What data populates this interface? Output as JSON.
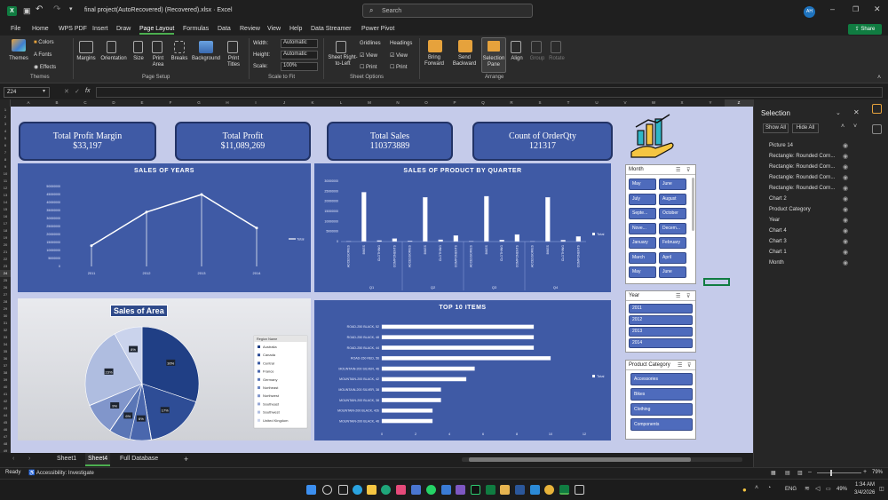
{
  "window": {
    "title": "final project(AutoRecovered) (Recovered).xlsx · Excel",
    "search": "Search",
    "user": "AH"
  },
  "menu": [
    "File",
    "Home",
    "WPS PDF",
    "Insert",
    "Draw",
    "Page Layout",
    "Formulas",
    "Data",
    "Review",
    "View",
    "Help",
    "Data Streamer",
    "Power Pivot"
  ],
  "share": "Share",
  "ribbon": {
    "themes": "Themes",
    "colors": "Colors",
    "fonts": "Fonts",
    "effects": "Effects",
    "themes_group": "Themes",
    "margins": "Margins",
    "orientation": "Orientation",
    "size": "Size",
    "print_area": "Print Area",
    "breaks": "Breaks",
    "background": "Background",
    "print_titles": "Print Titles",
    "page_setup_group": "Page Setup",
    "width": "Width:",
    "height": "Height:",
    "scale": "Scale:",
    "width_val": "Automatic",
    "height_val": "Automatic",
    "scale_val": "100%",
    "scale_group": "Scale to Fit",
    "sheet_rtl": "Sheet Right-to-Left",
    "gridlines": "Gridlines",
    "headings": "Headings",
    "view": "View",
    "print": "Print",
    "sheet_options_group": "Sheet Options",
    "bring_forward": "Bring Forward",
    "send_backward": "Send Backward",
    "selection_pane": "Selection Pane",
    "align": "Align",
    "group": "Group",
    "rotate": "Rotate",
    "arrange_group": "Arrange"
  },
  "formula": {
    "namebox": "Z24",
    "fx": "fx",
    "value": ""
  },
  "columns": [
    "A",
    "B",
    "C",
    "D",
    "E",
    "F",
    "G",
    "H",
    "I",
    "J",
    "K",
    "L",
    "M",
    "N",
    "O",
    "P",
    "Q",
    "R",
    "S",
    "T",
    "U",
    "V",
    "W",
    "X",
    "Y",
    "Z"
  ],
  "rows": [
    "1",
    "2",
    "3",
    "4",
    "5",
    "6",
    "7",
    "8",
    "9",
    "10",
    "11",
    "12",
    "13",
    "14",
    "15",
    "16",
    "17",
    "18",
    "19",
    "20",
    "21",
    "22",
    "23",
    "24",
    "25",
    "26",
    "27",
    "28",
    "29",
    "30",
    "31",
    "32",
    "33",
    "34",
    "35",
    "36",
    "37",
    "38",
    "39",
    "40",
    "41",
    "42",
    "43",
    "44",
    "45",
    "46",
    "47",
    "48",
    "49"
  ],
  "kpis": [
    {
      "title": "Total Profit Margin",
      "value": "$33,197"
    },
    {
      "title": "Total Profit",
      "value": "$11,089,269"
    },
    {
      "title": "Total Sales",
      "value": "110373889"
    },
    {
      "title": "Count of OrderQty",
      "value": "121317"
    }
  ],
  "chart_data": [
    {
      "type": "line",
      "title": "SALES OF YEARS",
      "categories": [
        "2011",
        "2012",
        "2013",
        "2014"
      ],
      "series": [
        {
          "name": "Total",
          "values": [
            13000000,
            34000000,
            45000000,
            24000000
          ]
        }
      ],
      "ylim": [
        0,
        50000000
      ],
      "yticks": [
        "0",
        "5000000",
        "10000000",
        "15000000",
        "20000000",
        "25000000",
        "30000000",
        "35000000",
        "40000000",
        "45000000",
        "50000000"
      ],
      "legend": "right"
    },
    {
      "type": "bar",
      "title": "SALES OF PRODUCT BY QUARTER",
      "quarters": [
        "Q1",
        "Q2",
        "Q3",
        "Q4"
      ],
      "categories": [
        "ACCESSORIES",
        "BIKES",
        "CLOTHING",
        "COMPONENTS",
        "ACCESSORIES",
        "BIKES",
        "CLOTHING",
        "COMPONENTS",
        "ACCESSORIES",
        "BIKES",
        "CLOTHING",
        "COMPONENTS",
        "ACCESSORIES",
        "BIKES",
        "CLOTHING",
        "COMPONENTS"
      ],
      "series": [
        {
          "name": "Total",
          "values": [
            100000,
            24500000,
            500000,
            1500000,
            300000,
            22000000,
            900000,
            3000000,
            200000,
            22500000,
            800000,
            3500000,
            150000,
            22000000,
            700000,
            2500000
          ]
        }
      ],
      "ylim": [
        0,
        30000000
      ],
      "yticks": [
        "0",
        "5000000",
        "10000000",
        "15000000",
        "20000000",
        "25000000",
        "30000000"
      ],
      "legend": "right"
    },
    {
      "type": "pie",
      "title": "Sales of Area",
      "legend_title": "Region Name",
      "labels": [
        "Australia",
        "Canada",
        "Central",
        "France",
        "Germany",
        "Northeast",
        "Northwest",
        "Southeast",
        "Southwest",
        "United Kingdom"
      ],
      "values": [
        30,
        17,
        0.1,
        6,
        6,
        0.1,
        9,
        0.1,
        23,
        8
      ],
      "data_labels": [
        "30%",
        "17%",
        "0%",
        "6%",
        "6%",
        "0%",
        "9%",
        "0%",
        "23%",
        "8%"
      ],
      "legend": "right"
    },
    {
      "type": "bar",
      "orientation": "horizontal",
      "title": "TOP 10 ITEMS",
      "categories": [
        "ROAD-250 BLACK, 52",
        "ROAD-250 BLACK, 48",
        "ROAD-250 BLACK, 44",
        "ROAD-150 RED, 56",
        "MOUNTAIN-200 SILVER, 46",
        "MOUNTAIN-200 BLACK, 42",
        "MOUNTAIN-200 SILVER, 38",
        "MOUNTAIN-200 BLACK, 38",
        "MOUNTAIN-200 BLACK, 42b",
        "MOUNTAIN-200 BLACK, 46"
      ],
      "series": [
        {
          "name": "Total",
          "values": [
            9,
            9,
            9,
            10,
            5.5,
            5,
            3.5,
            3.5,
            3,
            3
          ]
        }
      ],
      "xlim": [
        0,
        12
      ],
      "xticks": [
        "0",
        "2",
        "4",
        "6",
        "8",
        "10",
        "12"
      ],
      "legend": "right"
    }
  ],
  "slicers": {
    "month": {
      "title": "Month",
      "items": [
        "May",
        "June",
        "July",
        "August",
        "Septe...",
        "October",
        "Nove...",
        "Decem...",
        "January",
        "February",
        "March",
        "April",
        "May",
        "June"
      ]
    },
    "year": {
      "title": "Year",
      "items": [
        "2011",
        "2012",
        "2013",
        "2014"
      ]
    },
    "category": {
      "title": "Product Category",
      "items": [
        "Accessories",
        "Bikes",
        "Clothing",
        "Components"
      ]
    }
  },
  "selection_pane": {
    "title": "Selection",
    "show_all": "Show All",
    "hide_all": "Hide All",
    "items": [
      "Picture 14",
      "Rectangle: Rounded Corn...",
      "Rectangle: Rounded Corn...",
      "Rectangle: Rounded Corn...",
      "Rectangle: Rounded Corn...",
      "Chart 2",
      "Product Category",
      "Year",
      "Chart 4",
      "Chart 3",
      "Chart 1",
      "Month"
    ]
  },
  "sheet_tabs": [
    "Sheet1",
    "Sheet4",
    "Full Database"
  ],
  "status": {
    "ready": "Ready",
    "accessibility": "Accessibility: Investigate",
    "zoom": "79%"
  },
  "taskbar": {
    "lang": "ENG",
    "battery": "49%",
    "time": "1:34 AM",
    "date": "3/4/2026"
  },
  "colors": {
    "panel": "#3f5aa5",
    "sheet": "#c5cbea",
    "accent": "#107c41"
  }
}
